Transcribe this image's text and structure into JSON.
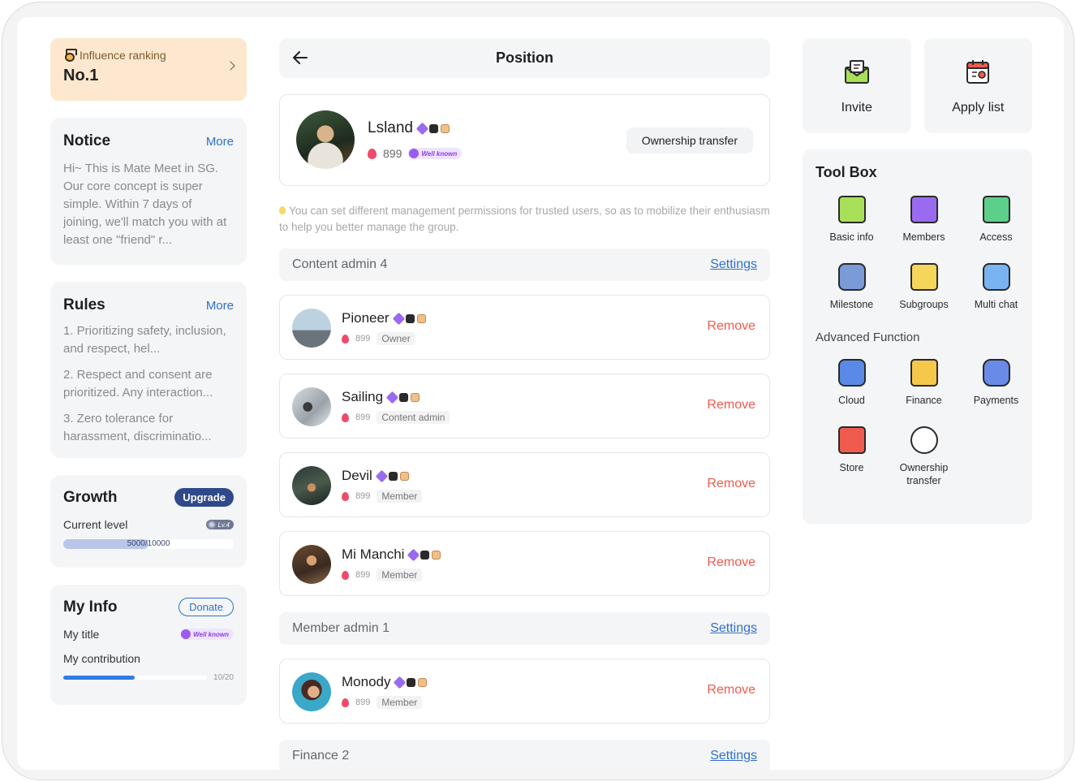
{
  "influence": {
    "label": "Influence ranking",
    "rank": "No.1"
  },
  "notice": {
    "title": "Notice",
    "more": "More",
    "text": "Hi~ This is Mate Meet in SG. Our core concept is super simple. Within 7 days of joining, we'll match you with at least one \"friend\" r..."
  },
  "rules": {
    "title": "Rules",
    "more": "More",
    "items": [
      "1. Prioritizing safety, inclusion, and respect, hel...",
      "2. Respect and consent are prioritized. Any interaction...",
      "3. Zero tolerance for harassment, discriminatio..."
    ]
  },
  "growth": {
    "title": "Growth",
    "upgrade": "Upgrade",
    "current_level_label": "Current level",
    "level_badge": "Lv.4",
    "progress_label": "5000/10000",
    "progress_fraction": 0.5
  },
  "myinfo": {
    "title": "My Info",
    "donate": "Donate",
    "title_label": "My title",
    "title_badge": "Well known",
    "contribution_label": "My contribution",
    "contribution_text": "10/20",
    "contribution_fraction": 0.5
  },
  "header": {
    "title": "Position"
  },
  "owner": {
    "name": "Lsland",
    "score": "899",
    "badge": "Well known",
    "transfer_button": "Ownership transfer"
  },
  "hint": "You can set different management permissions for trusted users, so as to mobilize their enthusiasm to help you better manage the group.",
  "sections": [
    {
      "title": "Content admin 4",
      "settings": "Settings",
      "members": [
        {
          "name": "Pioneer",
          "score": "899",
          "role": "Owner",
          "action": "Remove"
        },
        {
          "name": "Sailing",
          "score": "899",
          "role": "Content admin",
          "action": "Remove"
        },
        {
          "name": "Devil",
          "score": "899",
          "role": "Member",
          "action": "Remove"
        },
        {
          "name": "Mi Manchi",
          "score": "899",
          "role": "Member",
          "action": "Remove"
        }
      ]
    },
    {
      "title": "Member admin 1",
      "settings": "Settings",
      "members": [
        {
          "name": "Monody",
          "score": "899",
          "role": "Member",
          "action": "Remove"
        }
      ]
    },
    {
      "title": "Finance 2",
      "settings": "Settings",
      "members": []
    }
  ],
  "quick_actions": [
    {
      "label": "Invite",
      "icon": "invite-envelope-icon"
    },
    {
      "label": "Apply list",
      "icon": "apply-list-calendar-icon"
    }
  ],
  "toolbox": {
    "title": "Tool Box",
    "tools": [
      {
        "label": "Basic info",
        "icon": "basic-info-icon",
        "color": "#a8e05a"
      },
      {
        "label": "Members",
        "icon": "members-icon",
        "color": "#9a6bf0"
      },
      {
        "label": "Access",
        "icon": "access-icon",
        "color": "#5cd08a"
      },
      {
        "label": "Milestone",
        "icon": "milestone-road-icon",
        "color": "#7a9ad8"
      },
      {
        "label": "Subgroups",
        "icon": "subgroups-icon",
        "color": "#f5d65a"
      },
      {
        "label": "Multi chat",
        "icon": "multi-chat-icon",
        "color": "#7ab4f0"
      }
    ],
    "advanced_label": "Advanced Function",
    "advanced": [
      {
        "label": "Cloud",
        "icon": "cloud-icon",
        "color": "#5a8ae8"
      },
      {
        "label": "Finance",
        "icon": "finance-wallet-icon",
        "color": "#f5c84a"
      },
      {
        "label": "Payments",
        "icon": "stripe-payments-icon",
        "color": "#6a8ae8"
      },
      {
        "label": "Store",
        "icon": "store-icon",
        "color": "#ef5b4c"
      },
      {
        "label": "Ownership transfer",
        "icon": "ownership-transfer-icon",
        "color": "#ef5b4c"
      }
    ]
  }
}
